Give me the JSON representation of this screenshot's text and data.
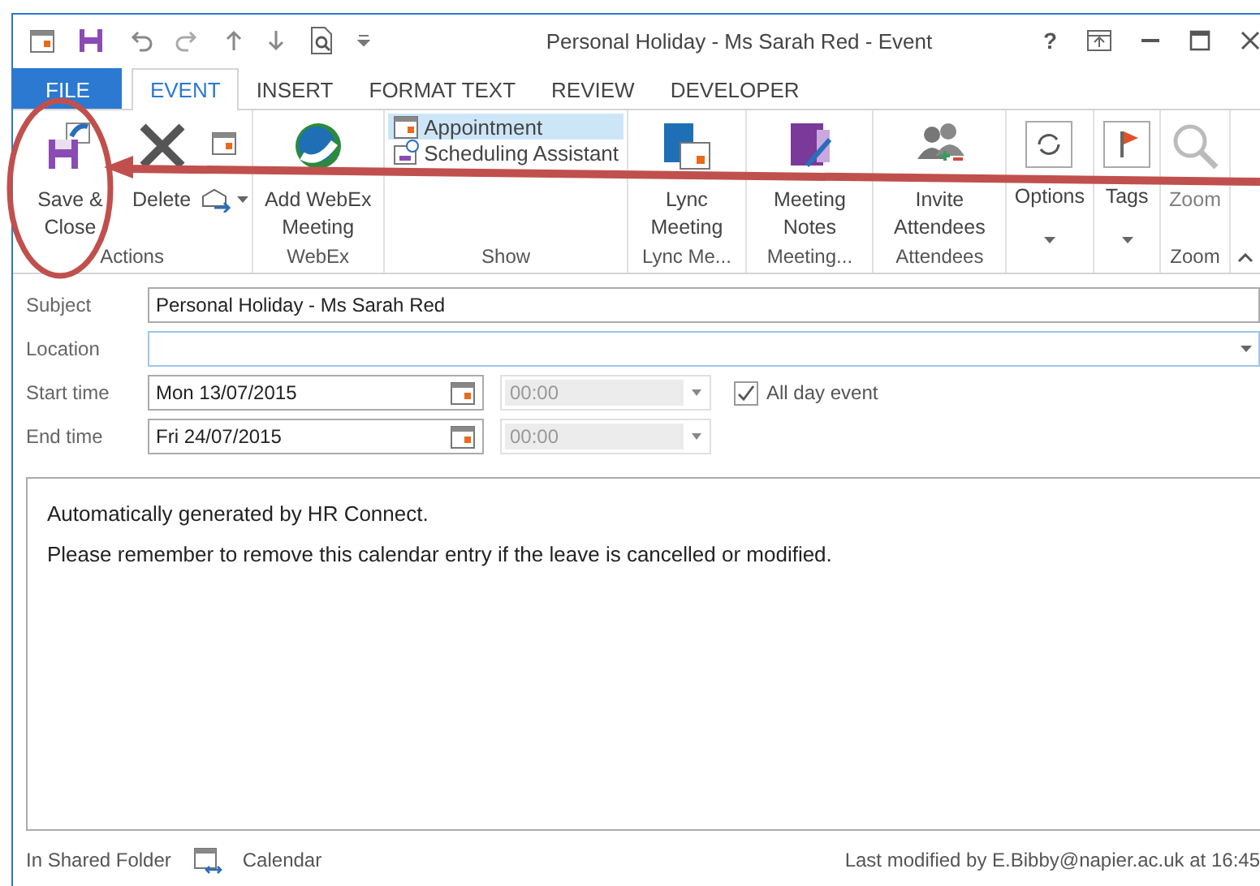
{
  "window": {
    "title": "Personal Holiday - Ms Sarah Red - Event",
    "help": "?"
  },
  "tabs": [
    {
      "label": "FILE",
      "kind": "file",
      "selected": false
    },
    {
      "label": "EVENT",
      "kind": "tab",
      "selected": true
    },
    {
      "label": "INSERT",
      "kind": "tab",
      "selected": false
    },
    {
      "label": "FORMAT TEXT",
      "kind": "tab",
      "selected": false
    },
    {
      "label": "REVIEW",
      "kind": "tab",
      "selected": false
    },
    {
      "label": "DEVELOPER",
      "kind": "tab",
      "selected": false
    }
  ],
  "ribbon": {
    "groups": [
      {
        "label": "Actions",
        "buttons": [
          {
            "label": "Save & Close",
            "kind": "large"
          },
          {
            "label": "Delete",
            "kind": "large"
          },
          {
            "kind": "stack"
          }
        ]
      },
      {
        "label": "WebEx",
        "buttons": [
          {
            "label": "Add WebEx Meeting",
            "kind": "large"
          }
        ]
      },
      {
        "label": "Show",
        "buttons": [
          {
            "label": "Appointment",
            "kind": "small",
            "selected": true
          },
          {
            "label": "Scheduling Assistant",
            "kind": "small",
            "selected": false
          }
        ]
      },
      {
        "label": "Lync Me...",
        "buttons": [
          {
            "label": "Lync Meeting",
            "kind": "large"
          }
        ]
      },
      {
        "label": "Meeting...",
        "buttons": [
          {
            "label": "Meeting Notes",
            "kind": "large"
          }
        ]
      },
      {
        "label": "Attendees",
        "buttons": [
          {
            "label": "Invite Attendees",
            "kind": "large"
          }
        ]
      },
      {
        "buttons": [
          {
            "label": "Options",
            "kind": "menu"
          }
        ]
      },
      {
        "buttons": [
          {
            "label": "Tags",
            "kind": "menu"
          }
        ]
      },
      {
        "label": "Zoom",
        "buttons": [
          {
            "label": "Zoom",
            "kind": "large",
            "disabled": true
          }
        ]
      }
    ]
  },
  "form": {
    "subject": {
      "label": "Subject",
      "value": "Personal Holiday - Ms Sarah Red"
    },
    "location": {
      "label": "Location"
    },
    "start": {
      "label": "Start time",
      "date": "Mon 13/07/2015",
      "time": "00:00"
    },
    "end": {
      "label": "End time",
      "date": "Fri 24/07/2015",
      "time": "00:00"
    },
    "all_day": {
      "label": "All day event",
      "checked": true
    }
  },
  "body": [
    "Automatically generated by HR Connect.",
    "Please remember to remove this calendar entry if the leave is cancelled or modified."
  ],
  "status_bar": {
    "folder": "In Shared Folder",
    "calendar": "Calendar",
    "modified": "Last modified by E.Bibby@napier.ac.uk at 16:45"
  }
}
